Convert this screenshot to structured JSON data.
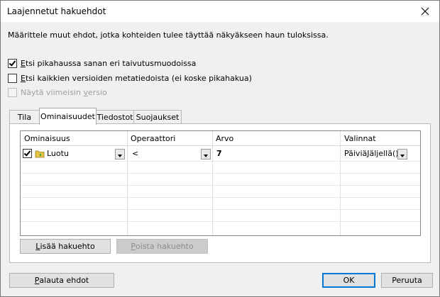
{
  "window": {
    "title": "Laajennetut hakuehdot",
    "description": "Määrittele muut ehdot, jotka kohteiden tulee täyttää näkyäkseen haun tuloksissa."
  },
  "options": {
    "inflection": {
      "label_key": "E",
      "label_rest": "tsi pikahaussa sanan eri taivutusmuodoissa",
      "checked": true
    },
    "all_versions": {
      "label_key": "E",
      "label_rest": "tsi kaikkien versioiden metatiedoista (ei koske pikahakua)",
      "checked": false
    },
    "latest_version": {
      "label_pre": "Näytä viimeisin ",
      "label_key": "v",
      "label_rest": "ersio",
      "checked": false,
      "enabled": false
    }
  },
  "tabs": [
    {
      "label": "Tila"
    },
    {
      "label": "Ominaisuudet",
      "active": true
    },
    {
      "label": "Tiedostot"
    },
    {
      "label": "Suojaukset"
    }
  ],
  "grid": {
    "headers": {
      "property": "Ominaisuus",
      "operator": "Operaattori",
      "value": "Arvo",
      "options": "Valinnat"
    },
    "rows": [
      {
        "checked": true,
        "property": "Luotu",
        "operator": "<",
        "value": "7",
        "options": "PäiviäJäljellä()"
      }
    ]
  },
  "buttons": {
    "add_condition": {
      "key": "L",
      "rest": "isää hakuehto"
    },
    "remove_condition": {
      "key": "P",
      "rest": "oista hakuehto"
    },
    "reset": {
      "key": "P",
      "rest": "alauta ehdot"
    },
    "ok": "OK",
    "cancel": "Peruuta"
  },
  "icons": {
    "close": "close-icon",
    "property": "folder-property-icon"
  },
  "colors": {
    "default_button_border": "#0078d7",
    "window_background": "#f0f0f0"
  }
}
